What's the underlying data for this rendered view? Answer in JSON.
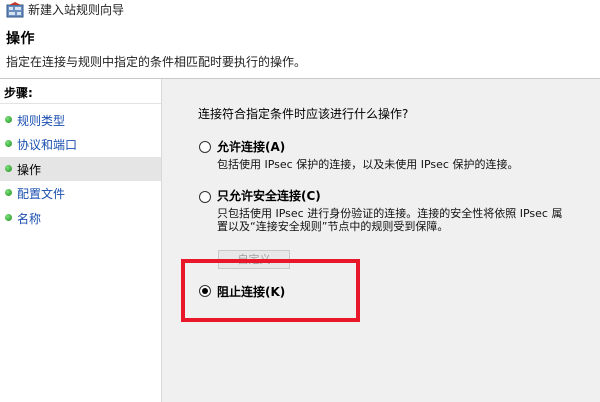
{
  "window": {
    "title": "新建入站规则向导"
  },
  "header": {
    "title": "操作",
    "description": "指定在连接与规则中指定的条件相匹配时要执行的操作。"
  },
  "sidebar": {
    "steps_label": "步骤:",
    "items": [
      {
        "label": "规则类型",
        "active": false
      },
      {
        "label": "协议和端口",
        "active": false
      },
      {
        "label": "操作",
        "active": true
      },
      {
        "label": "配置文件",
        "active": false
      },
      {
        "label": "名称",
        "active": false
      }
    ]
  },
  "main": {
    "question": "连接符合指定条件时应该进行什么操作?",
    "options": [
      {
        "label": "允许连接(A)",
        "description": "包括使用 IPsec 保护的连接，以及未使用 IPsec 保护的连接。",
        "checked": false
      },
      {
        "label": "只允许安全连接(C)",
        "description_line1": "只包括使用 IPsec 进行身份验证的连接。连接的安全性将依照 IPsec 属",
        "description_line2": "置以及“连接安全规则”节点中的规则受到保障。",
        "checked": false
      },
      {
        "label": "阻止连接(K)",
        "checked": true
      }
    ],
    "custom_button": "自定义"
  },
  "colors": {
    "highlight": "#e8182a",
    "step_link": "#1a4fb0",
    "step_dot": "#2aa22a"
  }
}
